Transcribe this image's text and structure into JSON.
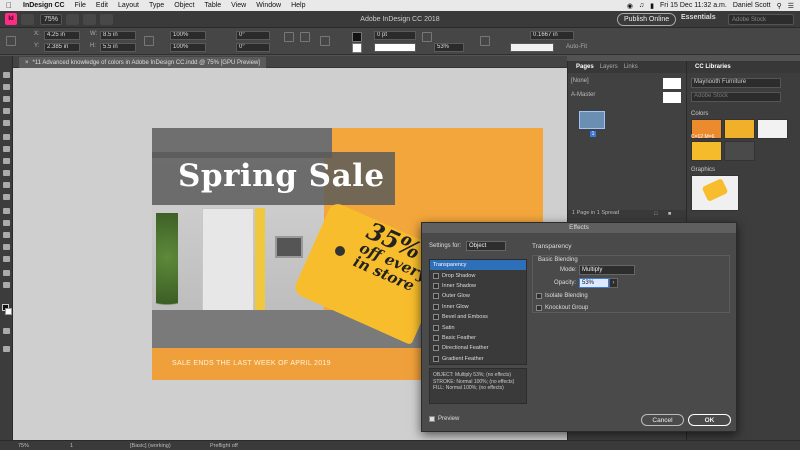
{
  "menubar": {
    "app_name": "InDesign CC",
    "items": [
      "File",
      "Edit",
      "Layout",
      "Type",
      "Object",
      "Table",
      "View",
      "Window",
      "Help"
    ],
    "clock": "Fri 15 Dec 11:32 a.m.",
    "user": "Daniel Scott"
  },
  "titlebar": {
    "logo": "Id",
    "zoom": "75%",
    "title": "Adobe InDesign CC 2018",
    "publish_label": "Publish Online",
    "workspace": "Essentials",
    "stock_placeholder": "Adobe Stock"
  },
  "controlbar": {
    "x_label": "X:",
    "x_value": "4.25 in",
    "y_label": "Y:",
    "y_value": "2.385 in",
    "w_label": "W:",
    "w_value": "8.5 in",
    "h_label": "H:",
    "h_value": "5.5 in",
    "scale_x": "100%",
    "scale_y": "100%",
    "rotate": "0°",
    "shear": "0°",
    "stroke_weight": "0 pt",
    "opacity": "53%",
    "gutter": "0.1667 in",
    "autofit_label": "Auto-Fit"
  },
  "document": {
    "tab_label": "*11 Advanced knowledge of colors in Adobe InDesign CC.indd @ 75% [GPU Preview]"
  },
  "artboard": {
    "title": "Spring Sale",
    "tag_line1": "35%",
    "tag_line2": "off everything",
    "tag_line3": "in store",
    "strip_text": "SALE ENDS THE LAST WEEK OF APRIL 2019"
  },
  "pages_panel": {
    "tabs": [
      "Pages",
      "Layers",
      "Links"
    ],
    "none_label": "[None]",
    "master_label": "A-Master",
    "page_number": "1",
    "footer": "1 Page in 1 Spread"
  },
  "cc_libraries": {
    "tab": "CC Libraries",
    "library": "Maynooth Furniture",
    "search_placeholder": "Adobe Stock",
    "colors_label": "Colors",
    "swatch_label": "C=12 M=6",
    "graphics_label": "Graphics",
    "swatch_colors": [
      "#ec8a2e",
      "#f0b02a",
      "#f2f2f2",
      "#f6bb2b",
      "#4a4a4a"
    ]
  },
  "effects": {
    "title": "Effects",
    "settings_label": "Settings for:",
    "settings_value": "Object",
    "section_title": "Transparency",
    "group_label": "Basic Blending",
    "mode_label": "Mode:",
    "mode_value": "Multiply",
    "opacity_label": "Opacity:",
    "opacity_value": "53%",
    "isolate_label": "Isolate Blending",
    "knockout_label": "Knockout Group",
    "list": [
      "Transparency",
      "Drop Shadow",
      "Inner Shadow",
      "Outer Glow",
      "Inner Glow",
      "Bevel and Emboss",
      "Satin",
      "Basic Feather",
      "Directional Feather",
      "Gradient Feather"
    ],
    "summary_object": "OBJECT: Multiply 53%; (no effects)",
    "summary_stroke": "STROKE: Normal 100%; (no effects)",
    "summary_fill": "FILL: Normal 100%; (no effects)",
    "preview_label": "Preview",
    "cancel_label": "Cancel",
    "ok_label": "OK"
  },
  "statusbar": {
    "zoom": "75%",
    "page": "1",
    "profile": "[Basic] (working)",
    "preflight": "Preflight off"
  }
}
